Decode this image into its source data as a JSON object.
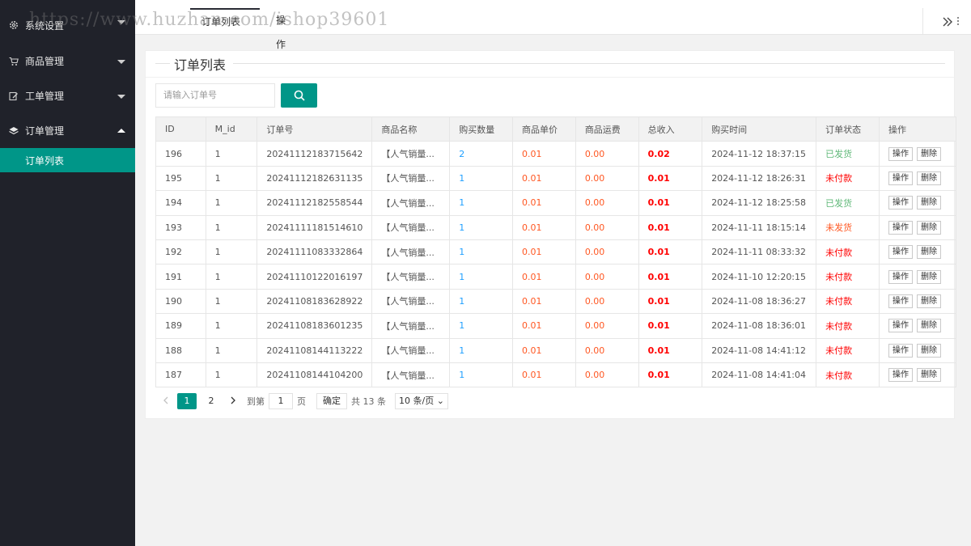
{
  "sidebar": {
    "items": [
      {
        "label": "系统设置",
        "icon": "gear-icon"
      },
      {
        "label": "商品管理",
        "icon": "cart-icon"
      },
      {
        "label": "工单管理",
        "icon": "edit-icon"
      },
      {
        "label": "订单管理",
        "icon": "layers-icon"
      }
    ],
    "sub_items": [
      {
        "label": "订单列表"
      }
    ]
  },
  "tabs": [
    {
      "label": "订单列表"
    },
    {
      "label": "操作"
    }
  ],
  "watermark": "https://www.huzhan.com/ishop39601",
  "panel": {
    "title": "订单列表",
    "search_placeholder": "请输入订单号"
  },
  "table": {
    "headers": [
      "ID",
      "M_id",
      "订单号",
      "商品名称",
      "购买数量",
      "商品单价",
      "商品运费",
      "总收入",
      "购买时间",
      "订单状态",
      "操作"
    ],
    "op_labels": [
      "操作",
      "删除"
    ],
    "rows": [
      {
        "id": "196",
        "mid": "1",
        "order_no": "20241112183715642",
        "product": "【人气销量...",
        "qty": "2",
        "price": "0.01",
        "freight": "0.00",
        "total": "0.02",
        "time": "2024-11-12 18:37:15",
        "status": "已发货"
      },
      {
        "id": "195",
        "mid": "1",
        "order_no": "20241112182631135",
        "product": "【人气销量...",
        "qty": "1",
        "price": "0.01",
        "freight": "0.00",
        "total": "0.01",
        "time": "2024-11-12 18:26:31",
        "status": "未付款"
      },
      {
        "id": "194",
        "mid": "1",
        "order_no": "20241112182558544",
        "product": "【人气销量...",
        "qty": "1",
        "price": "0.01",
        "freight": "0.00",
        "total": "0.01",
        "time": "2024-11-12 18:25:58",
        "status": "已发货"
      },
      {
        "id": "193",
        "mid": "1",
        "order_no": "20241111181514610",
        "product": "【人气销量...",
        "qty": "1",
        "price": "0.01",
        "freight": "0.00",
        "total": "0.01",
        "time": "2024-11-11 18:15:14",
        "status": "未发货"
      },
      {
        "id": "192",
        "mid": "1",
        "order_no": "20241111083332864",
        "product": "【人气销量...",
        "qty": "1",
        "price": "0.01",
        "freight": "0.00",
        "total": "0.01",
        "time": "2024-11-11 08:33:32",
        "status": "未付款"
      },
      {
        "id": "191",
        "mid": "1",
        "order_no": "20241110122016197",
        "product": "【人气销量...",
        "qty": "1",
        "price": "0.01",
        "freight": "0.00",
        "total": "0.01",
        "time": "2024-11-10 12:20:15",
        "status": "未付款"
      },
      {
        "id": "190",
        "mid": "1",
        "order_no": "20241108183628922",
        "product": "【人气销量...",
        "qty": "1",
        "price": "0.01",
        "freight": "0.00",
        "total": "0.01",
        "time": "2024-11-08 18:36:27",
        "status": "未付款"
      },
      {
        "id": "189",
        "mid": "1",
        "order_no": "20241108183601235",
        "product": "【人气销量...",
        "qty": "1",
        "price": "0.01",
        "freight": "0.00",
        "total": "0.01",
        "time": "2024-11-08 18:36:01",
        "status": "未付款"
      },
      {
        "id": "188",
        "mid": "1",
        "order_no": "20241108144113222",
        "product": "【人气销量...",
        "qty": "1",
        "price": "0.01",
        "freight": "0.00",
        "total": "0.01",
        "time": "2024-11-08 14:41:12",
        "status": "未付款"
      },
      {
        "id": "187",
        "mid": "1",
        "order_no": "20241108144104200",
        "product": "【人气销量...",
        "qty": "1",
        "price": "0.01",
        "freight": "0.00",
        "total": "0.01",
        "time": "2024-11-08 14:41:04",
        "status": "未付款"
      }
    ]
  },
  "pagination": {
    "pages": [
      "1",
      "2"
    ],
    "goto_label": "到第",
    "page_input": "1",
    "page_unit": "页",
    "confirm_label": "确定",
    "total_label": "共 13 条",
    "page_size_label": "10 条/页"
  },
  "colors": {
    "accent": "#009688",
    "sidebar_bg": "#20222a",
    "qty": "#1e9fff",
    "price": "#ff5722",
    "total": "#ff0000",
    "shipped": "#5fb878",
    "unpaid": "#ff0000",
    "not_shipped": "#ff5722"
  }
}
